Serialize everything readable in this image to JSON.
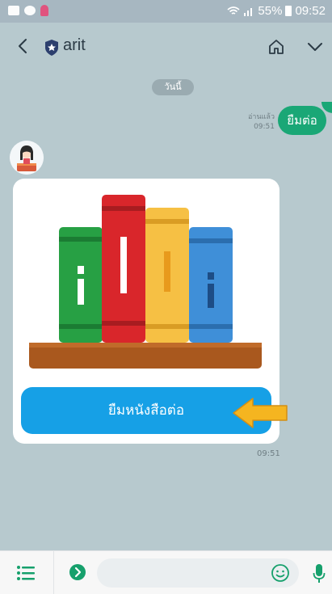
{
  "status_bar": {
    "battery": "55%",
    "time": "09:52"
  },
  "header": {
    "title": "arit"
  },
  "chat": {
    "date_separator": "วันนี้",
    "outgoing_message": {
      "text": "ยืมต่อ",
      "read_label": "อ่านแล้ว",
      "time": "09:51"
    },
    "incoming_card": {
      "button_label": "ยืมหนังสือต่อ",
      "time": "09:51"
    }
  },
  "composer": {
    "placeholder": ""
  },
  "colors": {
    "chat_background": "#b7c9ce",
    "outgoing_bubble": "#1aa776",
    "primary_button": "#16a0e6",
    "arrow": "#f5b520"
  }
}
